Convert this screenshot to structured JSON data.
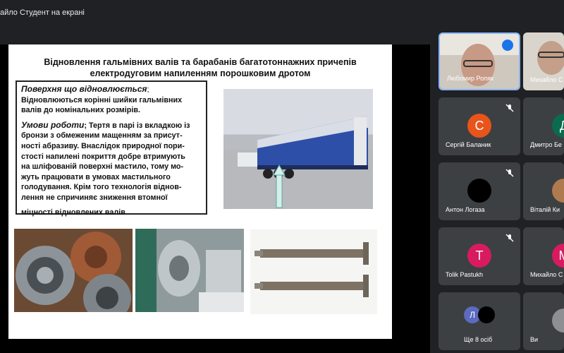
{
  "top_bar": {
    "title": "айло Студент на екрані"
  },
  "slide": {
    "title_line1": "Відновлення гальмівних валів та барабанів багатотоннажних причепів",
    "title_line2": "електродуговим напиленням порошковим дротом",
    "box": {
      "heading1": "Поверхня що відновлюється",
      "heading1_suffix": ";",
      "para1_line1": "Відновлюються корінні  шийки гальмівних",
      "para1_line2": "валів до номінальних розмірів.",
      "heading2": "Умови роботи",
      "para2_lines": [
        "; Тертя  в парі із вкладкою із",
        "бронзи  з обмеженим мащенням за присут-",
        "ності абразиву. Внаслідок природної пори-",
        "стості напилені покриття добре втримують",
        "на шліфованій поверхні мастило, тому мо-",
        "жуть працювати в умовах мастильного",
        "голодування. Крім того   технологія віднов-",
        "лення не спричиняє зниження втомної"
      ],
      "para2_last": "міцності відновлених валів"
    }
  },
  "participants": [
    {
      "name": "Любомир Ропяк",
      "type": "video",
      "muted": false,
      "speaking": true
    },
    {
      "name": "Михайло С",
      "type": "video",
      "muted": false
    },
    {
      "name": "Сергій Баланик",
      "type": "avatar",
      "initial": "С",
      "color": "#e8541a",
      "muted": true
    },
    {
      "name": "Дмитро Бе",
      "type": "avatar",
      "initial": "Д",
      "color": "#0b6b4c",
      "muted": false
    },
    {
      "name": "Антон Логаза",
      "type": "avatar",
      "initial": "",
      "color": "#000000",
      "muted": true
    },
    {
      "name": "Віталій Ки",
      "type": "photo",
      "muted": false
    },
    {
      "name": "Tolik Pastukh",
      "type": "avatar",
      "initial": "T",
      "color": "#d81b60",
      "muted": true
    },
    {
      "name": "Михайло С",
      "type": "avatar",
      "initial": "М",
      "color": "#d81b60",
      "muted": false
    },
    {
      "name": "Ще 8 осіб",
      "type": "group",
      "initial": "Л",
      "muted": false
    },
    {
      "name": "Ви",
      "type": "self",
      "muted": false
    }
  ],
  "colors": {
    "background": "#202124",
    "tile": "#3c4043",
    "active_border": "#8ab4f8",
    "mic_badge": "#1a73e8"
  }
}
